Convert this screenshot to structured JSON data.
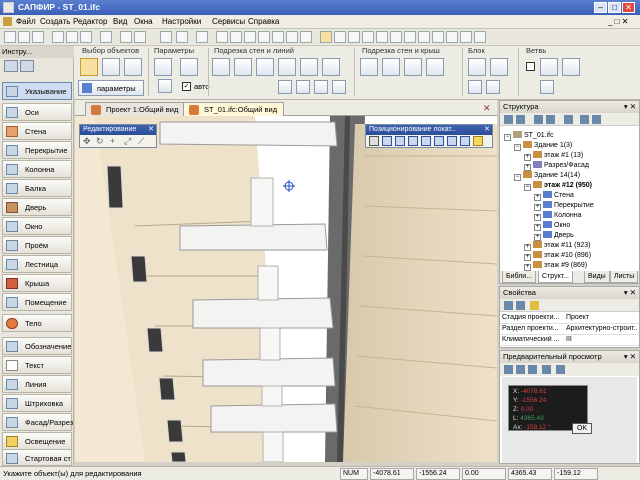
{
  "window": {
    "title": "САПФИР - ST_01.ifc",
    "minimize": "–",
    "maximize": "□",
    "close": "✕"
  },
  "menu": [
    "Файл",
    "Создать",
    "Редактор",
    "Вид",
    "Окна",
    "Настройки",
    "Сервисы",
    "Справка"
  ],
  "ribbon": {
    "groups": [
      "Выбор объектов",
      "Параметры",
      "Подрезка стен и линий",
      "Подрезка стен и крыш",
      "Блок",
      "Ветвь"
    ],
    "params_button": "параметры",
    "auto_label": "авто"
  },
  "toolbox": {
    "title": "Инстру...",
    "items": [
      "Указывание",
      "Оси",
      "Стена",
      "Перекрытие",
      "Колонна",
      "Балка",
      "Дверь",
      "Окно",
      "Проём",
      "Лестница",
      "Крыша",
      "Помещение",
      "Тело",
      "Обозначение",
      "Текст",
      "Линия",
      "Штриховка",
      "Фасад/Разрез",
      "Освещение",
      "Стартовая ст"
    ]
  },
  "tabs": [
    "Проект 1:Общий вид",
    "ST_01.ifc:Общий вид"
  ],
  "active_tab": 1,
  "panels": {
    "edit": "Редактирование",
    "position": "Позиционирование локат..."
  },
  "structure": {
    "title": "Структура",
    "items": [
      {
        "label": "ST_01.ifc",
        "level": 0
      },
      {
        "label": "Здание 1(3)",
        "level": 1
      },
      {
        "label": "этаж #1 (13)",
        "level": 2
      },
      {
        "label": "Разрез/Фасад",
        "level": 2
      },
      {
        "label": "Здание 14(14)",
        "level": 1
      },
      {
        "label": "этаж #12 (950)",
        "level": 2,
        "bold": true
      },
      {
        "label": "Стена",
        "level": 3
      },
      {
        "label": "Перекрытие",
        "level": 3
      },
      {
        "label": "Колонна",
        "level": 3
      },
      {
        "label": "Окно",
        "level": 3
      },
      {
        "label": "Дверь",
        "level": 3
      },
      {
        "label": "этаж #11 (923)",
        "level": 2
      },
      {
        "label": "этаж #10 (896)",
        "level": 2
      },
      {
        "label": "этаж #9 (869)",
        "level": 2
      }
    ],
    "bottom_tabs": [
      "Библи...",
      "Структ...",
      "Виды",
      "Листы"
    ]
  },
  "properties": {
    "title": "Свойства",
    "rows": [
      {
        "k": "Стадия проекти...",
        "v": "Проект"
      },
      {
        "k": "Раздел проекти...",
        "v": "Архитектурно-строит..."
      },
      {
        "k": "Климатический ...",
        "v": "III"
      }
    ]
  },
  "preview": {
    "title": "Предварительный просмотр",
    "coords": [
      {
        "k": "X:",
        "v": "-4078.61"
      },
      {
        "k": "Y:",
        "v": "-1556.24"
      },
      {
        "k": "Z:",
        "v": "0.00"
      },
      {
        "k": "L:",
        "v": "4365.43"
      },
      {
        "k": "Ax:",
        "v": "-159.12 °"
      }
    ],
    "ok": "OK"
  },
  "status": {
    "hint": "Укажите объект(ы) для редактирования",
    "num": "NUM",
    "x": "-4078.61",
    "y": "-1556.24",
    "z": "0.00",
    "l": "4365.43",
    "a": "-159.12"
  },
  "colors": {
    "accent": "#3a5fb8",
    "building": "#efe1c8",
    "slab": "#f2f2f0"
  }
}
